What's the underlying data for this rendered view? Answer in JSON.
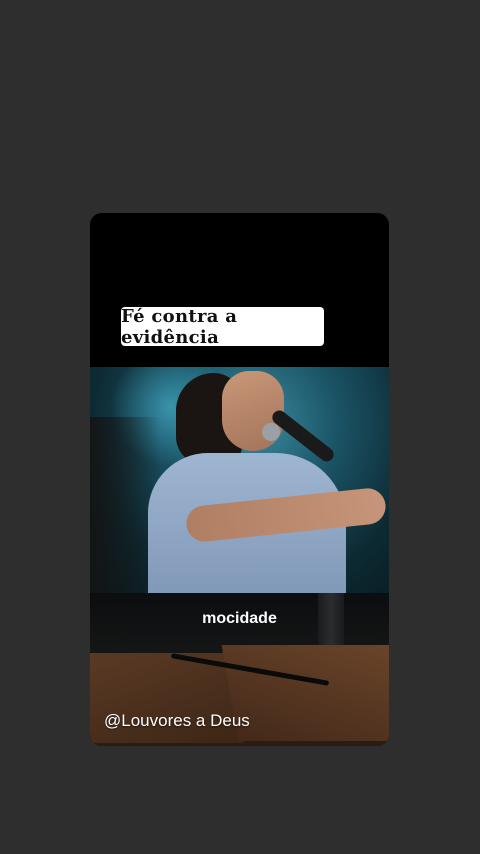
{
  "story": {
    "title": "Fé contra a evidência",
    "subtitle": "mocidade",
    "watermark": "@Louvores a Deus"
  },
  "colors": {
    "background": "#2f2e2e",
    "card": "#000000",
    "title_box": "#ffffff",
    "text_light": "#ffffff"
  }
}
